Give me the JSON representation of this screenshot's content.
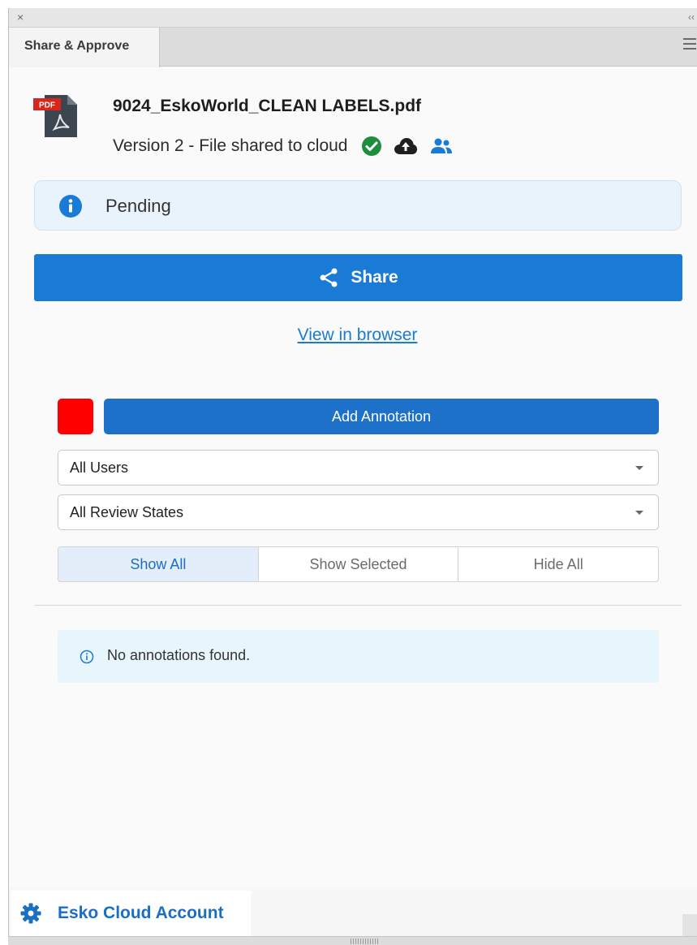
{
  "panel": {
    "close_glyph": "×",
    "collapse_glyph": "‹‹",
    "tab_label": "Share & Approve"
  },
  "file": {
    "icon_badge": "PDF",
    "name": "9024_EskoWorld_CLEAN LABELS.pdf",
    "version_text": "Version 2 - File shared to cloud",
    "status_icons": [
      "check-circle-icon",
      "cloud-upload-icon",
      "users-icon"
    ]
  },
  "status": {
    "label": "Pending"
  },
  "actions": {
    "share_label": "Share",
    "view_in_browser": "View in browser"
  },
  "annotations": {
    "color": "#ff0000",
    "add_label": "Add Annotation",
    "users_filter": "All Users",
    "review_filter": "All Review States",
    "visibility": [
      "Show All",
      "Show Selected",
      "Hide All"
    ],
    "visibility_selected": "Show All",
    "empty_message": "No annotations found."
  },
  "footer": {
    "account_label": "Esko Cloud Account"
  },
  "colors": {
    "accent": "#1a7bd6",
    "success": "#1e8e3e",
    "swatch": "#ff0000"
  }
}
